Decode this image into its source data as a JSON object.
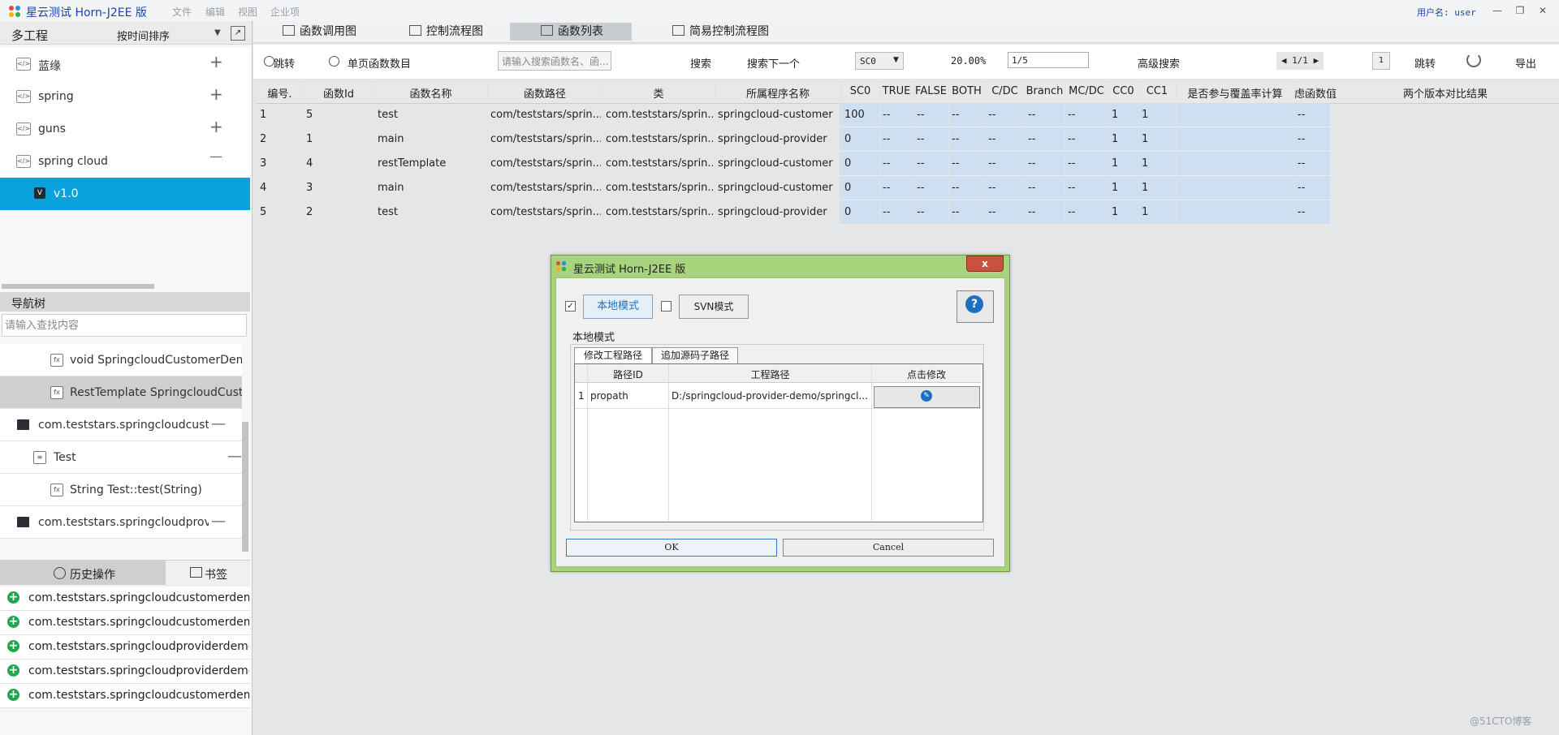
{
  "app": {
    "title": "星云测试 Horn-J2EE 版",
    "menu": [
      "文件",
      "编辑",
      "视图",
      "企业项"
    ],
    "user_label": "用户名: user",
    "window_buttons": [
      "minimize-icon",
      "restore-icon",
      "close-icon"
    ]
  },
  "left": {
    "projects_title": "多工程",
    "sort_label": "按时间排序",
    "projects": [
      {
        "label": "蓝缘",
        "action": "+"
      },
      {
        "label": "spring",
        "action": "+"
      },
      {
        "label": "guns",
        "action": "+"
      },
      {
        "label": "spring cloud",
        "action": "—"
      }
    ],
    "selected_version": "v1.0",
    "nav_title": "导航树",
    "nav_search_placeholder": "请输入查找内容",
    "nav_items": [
      {
        "label": "void SpringcloudCustomerDemoAp"
      },
      {
        "label": "RestTemplate SpringcloudCustome"
      },
      {
        "label": "com.teststars.springcloudcusto...",
        "action": "—"
      },
      {
        "label": "Test",
        "action": "—"
      },
      {
        "label": "String Test::test(String)"
      },
      {
        "label": "com.teststars.springcloudprovi...",
        "action": "—"
      }
    ],
    "tab_history": "历史操作",
    "tab_bookmark": "书签",
    "history": [
      "com.teststars.springcloudcustomerdemo/Sp",
      "com.teststars.springcloudcustomerdemo/Sp",
      "com.teststars.springcloudproviderdemo/Spri",
      "com.teststars.springcloudproviderdemo.cont",
      "com.teststars.springcloudcustomerdemo.cor"
    ]
  },
  "main": {
    "tabs": [
      "函数调用图",
      "控制流程图",
      "函数列表",
      "简易控制流程图"
    ],
    "toolbar": {
      "jump_radio": "跳转",
      "page_count_radio": "单页函数数目",
      "search_placeholder": "请输入搜索函数名、函...",
      "search": "搜索",
      "search_next": "搜索下一个",
      "metric_value": "SC0",
      "percent": "20.00%",
      "ratio": "1/5",
      "advanced": "高级搜索",
      "page_nav": "1/1",
      "page_input": "1",
      "goto": "跳转",
      "export": "导出"
    },
    "table": {
      "columns": [
        "编号.",
        "函数Id",
        "函数名称",
        "函数路径",
        "类",
        "所属程序名称",
        "SC0",
        "TRUE",
        "FALSE",
        "BOTH",
        "C/DC",
        "Branch",
        "MC/DC",
        "CC0",
        "CC1",
        "是否参与覆盖率计算",
        "虑函数值",
        "两个版本对比结果"
      ],
      "rows": [
        [
          "1",
          "5",
          "test",
          "com/teststars/sprin...",
          "com.teststars/sprin...",
          "springcloud-customer",
          "100",
          "--",
          "--",
          "--",
          "--",
          "--",
          "--",
          "1",
          "1",
          "",
          "--",
          ""
        ],
        [
          "2",
          "1",
          "main",
          "com/teststars/sprin...",
          "com.teststars/sprin...",
          "springcloud-provider",
          "0",
          "--",
          "--",
          "--",
          "--",
          "--",
          "--",
          "1",
          "1",
          "",
          "--",
          ""
        ],
        [
          "3",
          "4",
          "restTemplate",
          "com/teststars/sprin...",
          "com.teststars/sprin...",
          "springcloud-customer",
          "0",
          "--",
          "--",
          "--",
          "--",
          "--",
          "--",
          "1",
          "1",
          "",
          "--",
          ""
        ],
        [
          "4",
          "3",
          "main",
          "com/teststars/sprin...",
          "com.teststars/sprin...",
          "springcloud-customer",
          "0",
          "--",
          "--",
          "--",
          "--",
          "--",
          "--",
          "1",
          "1",
          "",
          "--",
          ""
        ],
        [
          "5",
          "2",
          "test",
          "com/teststars/sprin...",
          "com.teststars/sprin...",
          "springcloud-provider",
          "0",
          "--",
          "--",
          "--",
          "--",
          "--",
          "--",
          "1",
          "1",
          "",
          "--",
          ""
        ]
      ]
    }
  },
  "dialog": {
    "title": "星云测试 Horn-J2EE 版",
    "close": "x",
    "local_mode_button": "本地模式",
    "svn_mode_button": "SVN模式",
    "local_mode_checked": true,
    "svn_mode_checked": false,
    "local_mode_title": "本地模式",
    "tabs": [
      "修改工程路径",
      "追加源码子路径"
    ],
    "grid_columns": [
      "路径ID",
      "工程路径",
      "点击修改"
    ],
    "grid_rows": [
      {
        "index": "1",
        "path_id": "propath",
        "path": "D:/springcloud-provider-demo/springcl..."
      }
    ],
    "ok": "OK",
    "cancel": "Cancel"
  },
  "watermark": "@51CTO博客",
  "colors": {
    "accent": "#0aa2dd",
    "dialog_frame": "#a6d37c",
    "metrics_bg": "#cfdff2",
    "title_blue": "#1b45a8"
  }
}
